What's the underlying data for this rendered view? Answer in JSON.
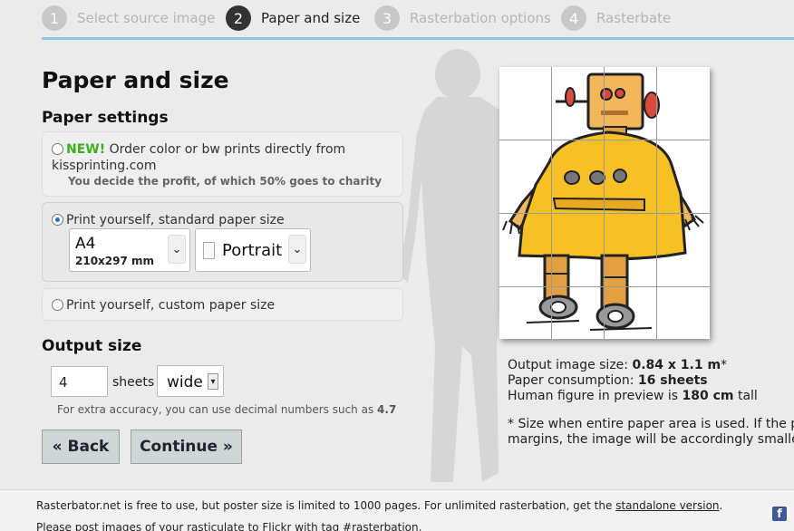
{
  "steps": [
    {
      "num": "1",
      "label": "Select source image"
    },
    {
      "num": "2",
      "label": "Paper and size"
    },
    {
      "num": "3",
      "label": "Rasterbation options"
    },
    {
      "num": "4",
      "label": "Rasterbate"
    }
  ],
  "page": {
    "title": "Paper and size"
  },
  "paper_settings": {
    "heading": "Paper settings",
    "option_kiss": {
      "new": "NEW!",
      "text": "Order color or bw prints directly from kissprinting.com",
      "sub": "You decide the profit, of which 50% goes to charity"
    },
    "option_standard": {
      "text": "Print yourself, standard paper size"
    },
    "paper_select": {
      "value": "A4",
      "dimensions": "210x297 mm"
    },
    "orientation_select": {
      "value": "Portrait"
    },
    "option_custom": {
      "text": "Print yourself, custom paper size"
    }
  },
  "output": {
    "heading": "Output size",
    "sheets_value": "4",
    "sheets_label": "sheets",
    "direction": "wide",
    "hint_prefix": "For extra accuracy, you can use decimal numbers such as",
    "hint_value": "4.7"
  },
  "buttons": {
    "back": "« Back",
    "continue": "Continue »"
  },
  "summary": {
    "size_label": "Output image size:",
    "size_value": "0.84 x 1.1 m",
    "size_suffix": "*",
    "paper_label": "Paper consumption:",
    "paper_value": "16 sheets",
    "human_prefix": "Human figure in preview is",
    "human_value": "180 cm",
    "human_suffix": "tall",
    "note_line1": "* Size when entire paper area is used. If the p",
    "note_line2": "margins, the image will be accordingly smaller"
  },
  "footer": {
    "line1_text": "Rasterbator.net is free to use, but poster size is limited to 1000 pages. For unlimited rasterbation, get the",
    "line1_link": "standalone version",
    "line1_end": ".",
    "line2_text": "Please post images of your rasticulate to",
    "line2_link": "Flickr",
    "line2_mid": "with tag",
    "line2_tag": "#rasterbation",
    "line2_end": "."
  },
  "colors": {
    "accent_line": "#8ec9e0",
    "new_green": "#3fae1e",
    "radio_blue": "#2a6fd6"
  }
}
